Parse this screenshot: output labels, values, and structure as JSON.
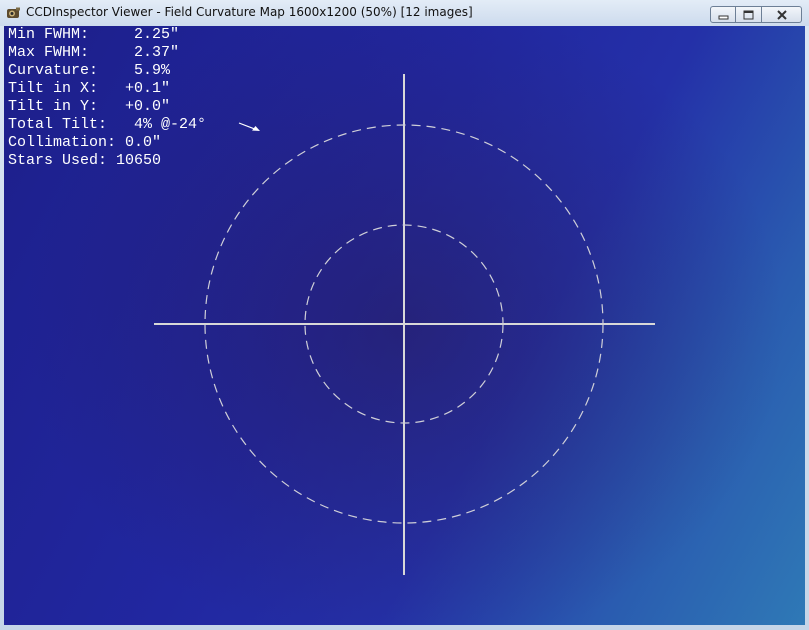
{
  "window": {
    "title": "CCDInspector Viewer - Field Curvature Map 1600x1200 (50%)  [12 images]"
  },
  "title_controls": [
    "minimize-icon",
    "maximize-icon",
    "close-icon"
  ],
  "stats": [
    "Min FWHM:     2.25\"",
    "Max FWHM:     2.37\"",
    "Curvature:    5.9%",
    "Tilt in X:   +0.1\"",
    "Tilt in Y:   +0.0\"",
    "Total Tilt:   4% @-24°",
    "Collimation: 0.0\"",
    "Stars Used: 10650"
  ],
  "tilt": {
    "percent": 4,
    "angle_deg": -24
  },
  "colors": {
    "background_dark": "#1d1f8a",
    "background_light": "#2f79b6",
    "overlay_lines": "#d8d8d8"
  }
}
